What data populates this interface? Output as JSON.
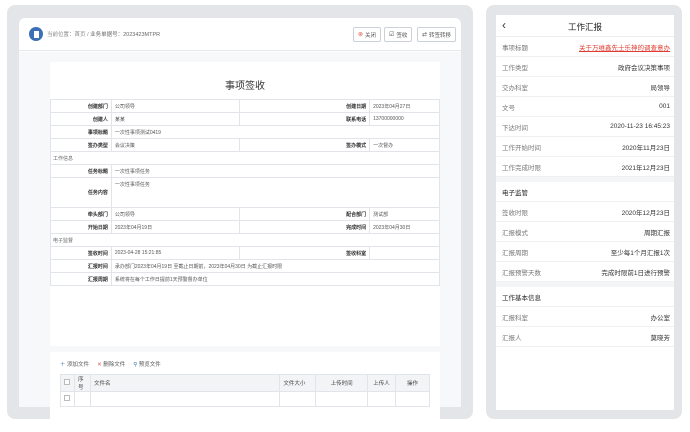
{
  "left": {
    "breadcrumb": {
      "prefix": "当前位置：",
      "home": "首页",
      "sep": "/",
      "current": "业务单据号：2023423MTPR"
    },
    "toolbar": {
      "close_label": "关闭",
      "save_label": "签收",
      "export_label": "转签转移"
    },
    "form": {
      "title": "事项签收",
      "rows": {
        "create_dept_label": "创建部门",
        "create_dept_value": "公司领导",
        "create_date_label": "创建日期",
        "create_date_value": "2023年04月27日",
        "creator_label": "创建人",
        "creator_value": "某某",
        "phone_label": "联系电话",
        "phone_value": "13700000000",
        "item_title_label": "事项标题",
        "item_title_value": "一次性事项测试0419",
        "sign_type_label": "签办类型",
        "sign_type_value": "会议决策",
        "sign_mode_label": "签办模式",
        "sign_mode_value": "一次督办",
        "section_work": "工作信息",
        "task_title_label": "任务标题",
        "task_title_value": "一次性事项任务",
        "task_content_label": "任务内容",
        "task_content_value": "一次性事项任务",
        "lead_dept_label": "牵头部门",
        "lead_dept_value": "公司领导",
        "coop_dept_label": "配合部门",
        "coop_dept_value": "测试部",
        "start_label": "开始日期",
        "start_value": "2023年04月19日",
        "end_label": "完成时间",
        "end_value": "2023年04月30日",
        "section_supervise": "电子监督",
        "sign_time_label": "签收时间",
        "sign_time_value": "2023-04-28 15:21:85",
        "sign_person_label": "签收科室",
        "sign_person_value": "",
        "report_time_label": "汇报时间",
        "report_time_value": "承办部门2023年04月19日 至截止日期前，2023年04月30日 为截止汇报时限",
        "report_period_label": "汇报周期",
        "report_period_value": "系统将在每个工作日提前1天预警督办单位"
      }
    },
    "attach": {
      "add_label": "添加文件",
      "delete_label": "删除文件",
      "preview_label": "预览文件",
      "headers": [
        "序号",
        "文件名",
        "文件大小",
        "上传时间",
        "上传人",
        "操作"
      ]
    }
  },
  "right": {
    "title": "工作汇报",
    "back_icon": "chevron-left-icon",
    "rows": [
      {
        "k": "事项标题",
        "v": "关于万维鑫先士乐神的调查意办",
        "link": true
      },
      {
        "k": "工作类型",
        "v": "政府会议决策事项"
      },
      {
        "k": "交办科室",
        "v": "局领导"
      },
      {
        "k": "文号",
        "v": "001"
      },
      {
        "k": "下达时间",
        "v": "2020-11-23 16:45:23"
      },
      {
        "k": "工作开始时间",
        "v": "2020年11月23日"
      },
      {
        "k": "工作完成时限",
        "v": "2021年12月23日"
      }
    ],
    "sect2": "电子监管",
    "rows2": [
      {
        "k": "签收时限",
        "v": "2020年12月23日"
      },
      {
        "k": "汇报模式",
        "v": "周期汇报"
      },
      {
        "k": "汇报周期",
        "v": "至少每1个月汇报1次"
      },
      {
        "k": "汇报预警天数",
        "v": "完成时限前1日进行预警"
      }
    ],
    "sect3": "工作基本信息",
    "rows3": [
      {
        "k": "汇报科室",
        "v": "办公室"
      },
      {
        "k": "汇报人",
        "v": "莫晓芳"
      }
    ]
  },
  "colors": {
    "accent": "#3d6fb6",
    "danger": "#e03c31",
    "panel_bg": "#e3e5e8"
  }
}
